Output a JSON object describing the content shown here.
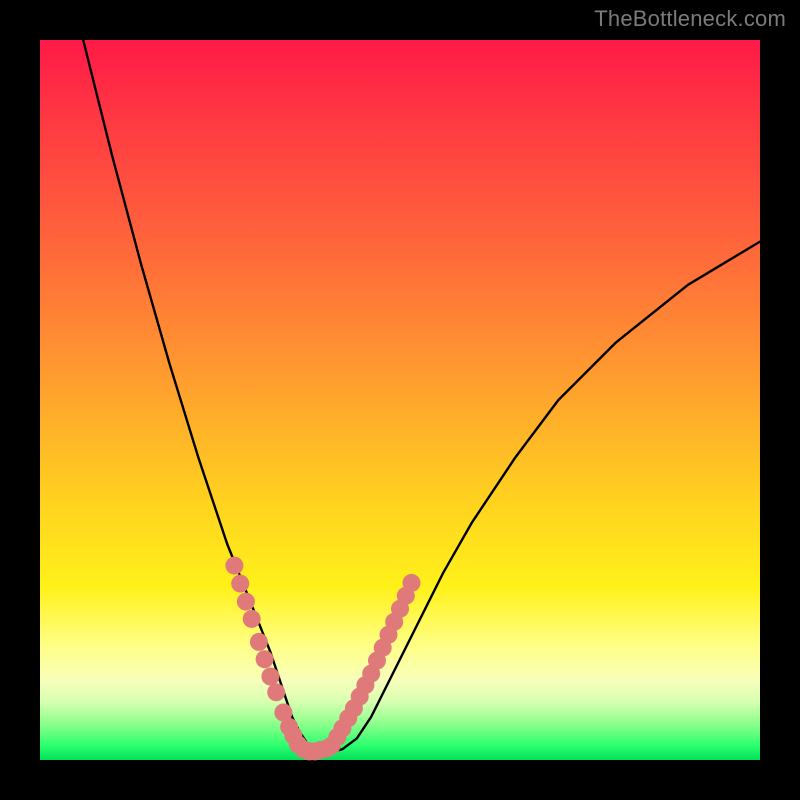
{
  "watermark": "TheBottleneck.com",
  "colors": {
    "frame": "#000000",
    "curve": "#000000",
    "marker": "#e07a7a",
    "gradient_stops": [
      "#ff1a47",
      "#ff6a3a",
      "#ffd21f",
      "#ffff85",
      "#2bff6e"
    ]
  },
  "chart_data": {
    "type": "line",
    "title": "",
    "xlabel": "",
    "ylabel": "",
    "xlim": [
      0,
      100
    ],
    "ylim": [
      0,
      100
    ],
    "grid": false,
    "legend": false,
    "series": [
      {
        "name": "bottleneck-curve",
        "x": [
          6,
          10,
          14,
          18,
          22,
          26,
          28,
          30,
          32,
          33,
          34,
          35,
          36,
          37,
          38,
          39,
          40,
          42,
          44,
          46,
          48,
          52,
          56,
          60,
          66,
          72,
          80,
          90,
          100
        ],
        "y": [
          100,
          84,
          69,
          55,
          42,
          30,
          25,
          20,
          15,
          12,
          9,
          6,
          4,
          2.5,
          1.5,
          1,
          1,
          1.5,
          3,
          6,
          10,
          18,
          26,
          33,
          42,
          50,
          58,
          66,
          72
        ]
      }
    ],
    "markers": [
      {
        "name": "left-branch-dots",
        "x": [
          27.0,
          27.8,
          28.6,
          29.4,
          30.4,
          31.2,
          32.0,
          32.8,
          33.8,
          34.6,
          35.2
        ],
        "y": [
          27.0,
          24.5,
          22.0,
          19.6,
          16.4,
          14.0,
          11.6,
          9.4,
          6.6,
          4.6,
          3.4
        ]
      },
      {
        "name": "right-branch-dots",
        "x": [
          40.5,
          41.3,
          42.0,
          42.8,
          43.6,
          44.4,
          45.2,
          46.0,
          46.8,
          47.6,
          48.4,
          49.2,
          50.0,
          50.8,
          51.6
        ],
        "y": [
          2.0,
          3.2,
          4.4,
          5.8,
          7.2,
          8.8,
          10.4,
          12.0,
          13.8,
          15.6,
          17.4,
          19.2,
          21.0,
          22.8,
          24.6
        ]
      },
      {
        "name": "valley-floor-dots",
        "x": [
          35.8,
          36.6,
          37.4,
          38.2,
          39.0,
          39.8
        ],
        "y": [
          2.2,
          1.5,
          1.2,
          1.2,
          1.4,
          1.6
        ]
      }
    ]
  }
}
